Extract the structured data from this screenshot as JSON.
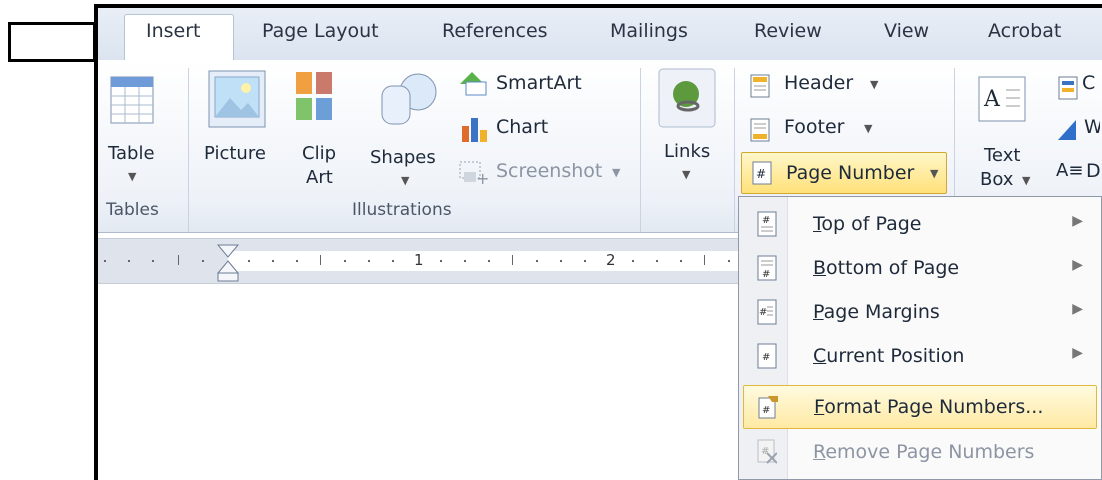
{
  "tabs": [
    "Insert",
    "Page Layout",
    "References",
    "Mailings",
    "Review",
    "View",
    "Acrobat"
  ],
  "active_tab": "Insert",
  "groups": {
    "tables": {
      "label": "Tables",
      "table_label": "Table"
    },
    "illustrations": {
      "label": "Illustrations",
      "picture": "Picture",
      "clip_art_1": "Clip",
      "clip_art_2": "Art",
      "shapes": "Shapes",
      "smartart": "SmartArt",
      "chart": "Chart",
      "screenshot": "Screenshot"
    },
    "links": {
      "label": "Links"
    },
    "header_footer": {
      "header": "Header",
      "footer": "Footer",
      "page_number": "Page Number"
    },
    "text": {
      "text_box_1": "Text",
      "text_box_2": "Box"
    }
  },
  "ruler": {
    "marks": [
      "1",
      "2"
    ]
  },
  "menu": {
    "items": [
      {
        "label": "Top of Page",
        "accel": "T",
        "rest": "op of Page",
        "submenu": true
      },
      {
        "label": "Bottom of Page",
        "accel": "B",
        "rest": "ottom of Page",
        "submenu": true
      },
      {
        "label": "Page Margins",
        "accel": "P",
        "rest": "age Margins",
        "submenu": true
      },
      {
        "label": "Current Position",
        "accel": "C",
        "rest": "urrent Position",
        "submenu": true
      },
      {
        "label": "Format Page Numbers...",
        "accel": "F",
        "rest": "ormat Page Numbers...",
        "submenu": false,
        "highlighted": true
      },
      {
        "label": "Remove Page Numbers",
        "accel": "R",
        "rest": "emove Page Numbers",
        "submenu": false,
        "disabled": true
      }
    ]
  },
  "colors": {
    "highlight": "#ffe17a",
    "ribbon_bg": "#eef2f8",
    "frame": "#000000"
  }
}
